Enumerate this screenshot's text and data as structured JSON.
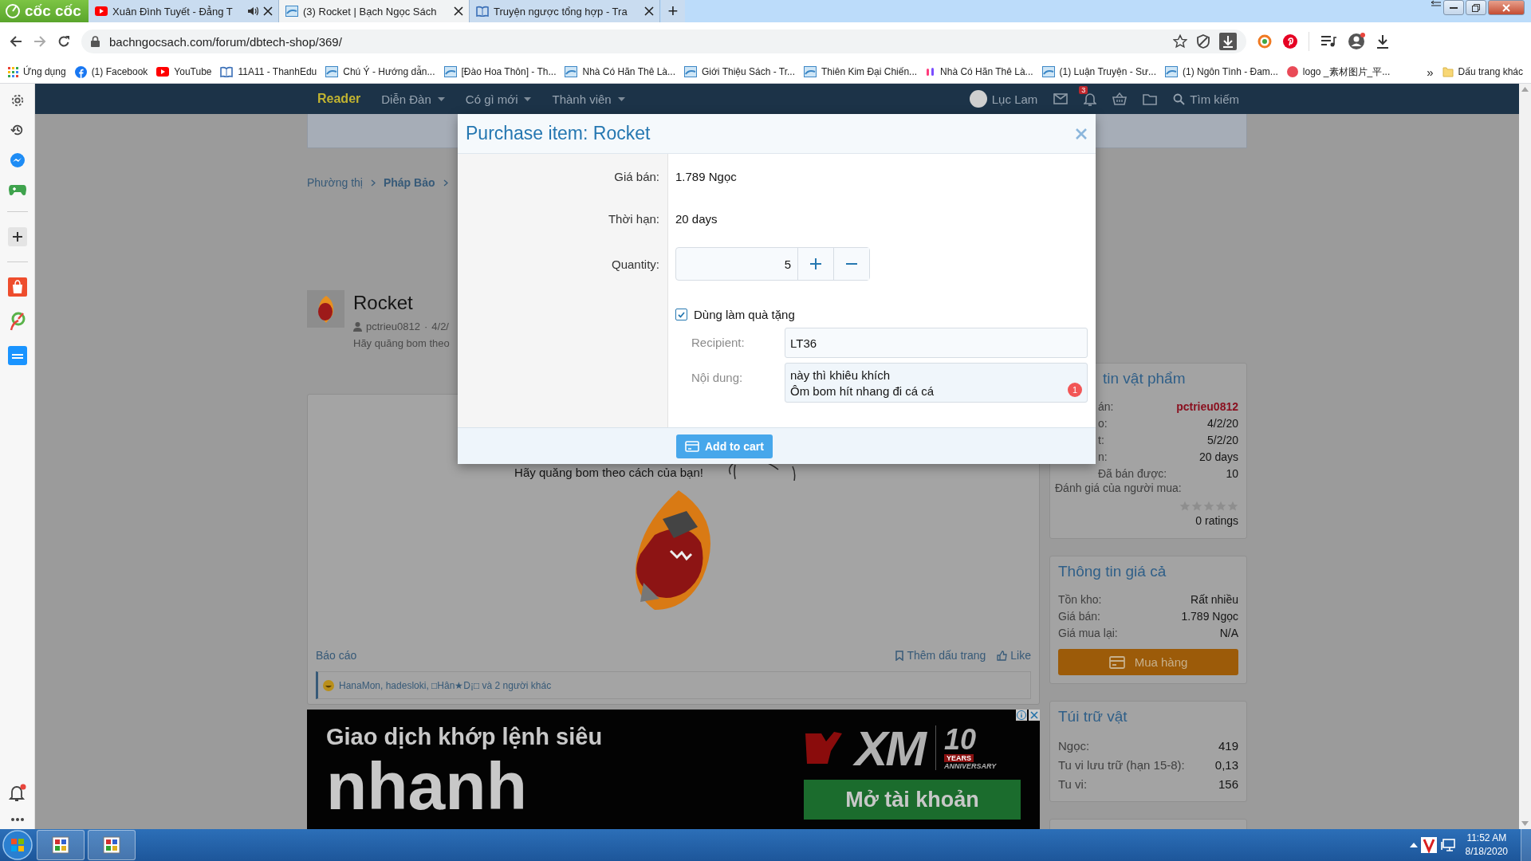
{
  "browser": {
    "brand": "cốc cốc",
    "tabs": [
      {
        "title": "Xuân Đình Tuyết - Đẳng T",
        "kind": "youtube",
        "audio": true,
        "selected": false
      },
      {
        "title": "(3) Rocket | Bạch Ngọc Sách",
        "kind": "site",
        "audio": false,
        "selected": true
      },
      {
        "title": "Truyện ngược tổng hợp - Tra",
        "kind": "book",
        "audio": false,
        "selected": false
      }
    ],
    "new_tab": "+",
    "url": "bachngocsach.com/forum/dbtech-shop/369/",
    "bookmarks": [
      {
        "label": "Ứng dụng",
        "kind": "apps"
      },
      {
        "label": "(1) Facebook",
        "kind": "facebook"
      },
      {
        "label": "YouTube",
        "kind": "youtube"
      },
      {
        "label": "11A11 - ThanhEdu",
        "kind": "book"
      },
      {
        "label": "Chú Ý - Hướng dẫn...",
        "kind": "site"
      },
      {
        "label": "[Đào Hoa Thôn] - Th...",
        "kind": "site"
      },
      {
        "label": "Nhà Có Hãn Thê Là...",
        "kind": "site"
      },
      {
        "label": "Giới Thiệu Sách - Tr...",
        "kind": "site"
      },
      {
        "label": "Thiên Kim Đại Chiến...",
        "kind": "site"
      },
      {
        "label": "Nhà Có Hãn Thê Là...",
        "kind": "multi"
      },
      {
        "label": "(1) Luận Truyện - Sư...",
        "kind": "site"
      },
      {
        "label": "(1) Ngôn Tình - Đam...",
        "kind": "site"
      },
      {
        "label": "logo _素材图片_平...",
        "kind": "logo"
      }
    ],
    "more_bookmarks": "»",
    "other_bookmarks": "Dấu trang khác"
  },
  "nav": {
    "items": [
      {
        "label": "Reader",
        "selected": true,
        "dropdown": false
      },
      {
        "label": "Diễn Đàn",
        "selected": false,
        "dropdown": true
      },
      {
        "label": "Có gì mới",
        "selected": false,
        "dropdown": true
      },
      {
        "label": "Thành viên",
        "selected": false,
        "dropdown": true
      }
    ],
    "user": "Lục Lam",
    "alerts_badge": "3",
    "search": "Tìm kiếm"
  },
  "breadcrumb": [
    "Phường thị",
    "Pháp Bảo"
  ],
  "item": {
    "title": "Rocket",
    "author": "pctrieu0812",
    "separator": "·",
    "date": "4/2/",
    "description": "Hãy quăng bom theo"
  },
  "post": {
    "caption": "Hãy quăng bom theo cách của bạn!",
    "report": "Báo cáo",
    "bookmark": "Thêm dấu trang",
    "like": "Like",
    "reactions": "HanaMon, hadesloki, □Hân★D¡□ và 2 người khác"
  },
  "ad": {
    "headline": "Giao dịch khớp lệnh siêu",
    "headline_big": "nhanh",
    "brand": "XM",
    "anniversary_number": "10",
    "anniversary_years": "YEARS",
    "anniversary_label": "ANNIVERSARY",
    "cta": "Mở tài khoản"
  },
  "sidebar": {
    "cards": [
      {
        "kind": "info",
        "title": "tin vật phẩm",
        "rows": [
          {
            "label": "án:",
            "value": "pctrieu0812",
            "highlight": true
          },
          {
            "label": "o:",
            "value": "4/2/20",
            "highlight": false
          },
          {
            "label": "t:",
            "value": "5/2/20",
            "highlight": false
          },
          {
            "label": "n:",
            "value": "20 days",
            "highlight": false
          },
          {
            "label": "Đã bán được:",
            "value": "10",
            "highlight": false
          }
        ],
        "rating_label": "Đánh giá của người mua:",
        "stars": 0,
        "ratings": "0 ratings"
      },
      {
        "kind": "price",
        "title": "Thông tin giá cả",
        "rows": [
          {
            "label": "Tồn kho:",
            "value": "Rất nhiều",
            "highlight": false
          },
          {
            "label": "Giá bán:",
            "value": "1.789 Ngọc",
            "highlight": false
          },
          {
            "label": "Giá mua lại:",
            "value": "N/A",
            "highlight": false
          }
        ],
        "button": "Mua hàng"
      },
      {
        "kind": "wallet",
        "title": "Túi trữ vật",
        "rows": [
          {
            "label": "Ngọc:",
            "value": "419",
            "highlight": false
          },
          {
            "label": "Tu vi lưu trữ (hạn 15-8):",
            "value": "0,13",
            "highlight": false
          },
          {
            "label": "Tu vi:",
            "value": "156",
            "highlight": false
          }
        ]
      }
    ]
  },
  "modal": {
    "title": "Purchase item: Rocket",
    "fields": [
      {
        "label": "Giá bán:",
        "value": "1.789 Ngọc"
      },
      {
        "label": "Thời hạn:",
        "value": "20 days"
      }
    ],
    "quantity": {
      "label": "Quantity:",
      "value": "5"
    },
    "gift": {
      "label": "Dùng làm quà tặng",
      "checked": true,
      "recipient_label": "Recipient:",
      "recipient": "LT36",
      "message_label": "Nội dung:",
      "message": "này thì khiêu khích\nÔm bom hít nhang đi cá cá",
      "spell_badge": "1"
    },
    "submit": "Add to cart"
  },
  "taskbar": {
    "time": "11:52 AM",
    "date": "8/18/2020"
  }
}
